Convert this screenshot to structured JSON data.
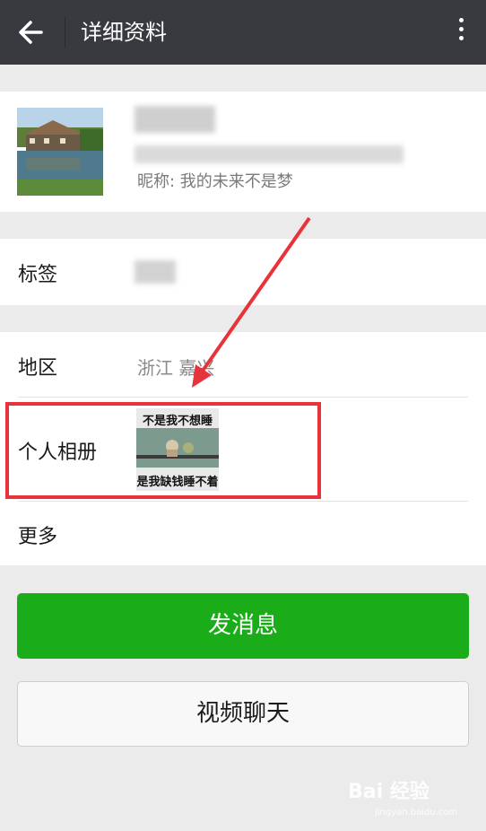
{
  "header": {
    "title": "详细资料"
  },
  "profile": {
    "nickname": "昵称: 我的未来不是梦"
  },
  "tag": {
    "label": "标签"
  },
  "region": {
    "label": "地区",
    "value": "浙江  嘉兴"
  },
  "album": {
    "label": "个人相册",
    "thumb_text_top": "不是我不想睡",
    "thumb_text_bottom": "是我缺钱睡不着"
  },
  "more": {
    "label": "更多"
  },
  "actions": {
    "send_label": "发消息",
    "video_label": "视频聊天"
  },
  "watermark": {
    "text": "Bai 经验",
    "sub": "jingyan.baidu.com"
  },
  "colors": {
    "topbar": "#393a3f",
    "send_button": "#1aad19",
    "highlight_box": "#e8333a",
    "annotation_arrow": "#e8333a"
  },
  "icons": {
    "back": "arrow-left-icon",
    "more": "vertical-dots-icon"
  }
}
